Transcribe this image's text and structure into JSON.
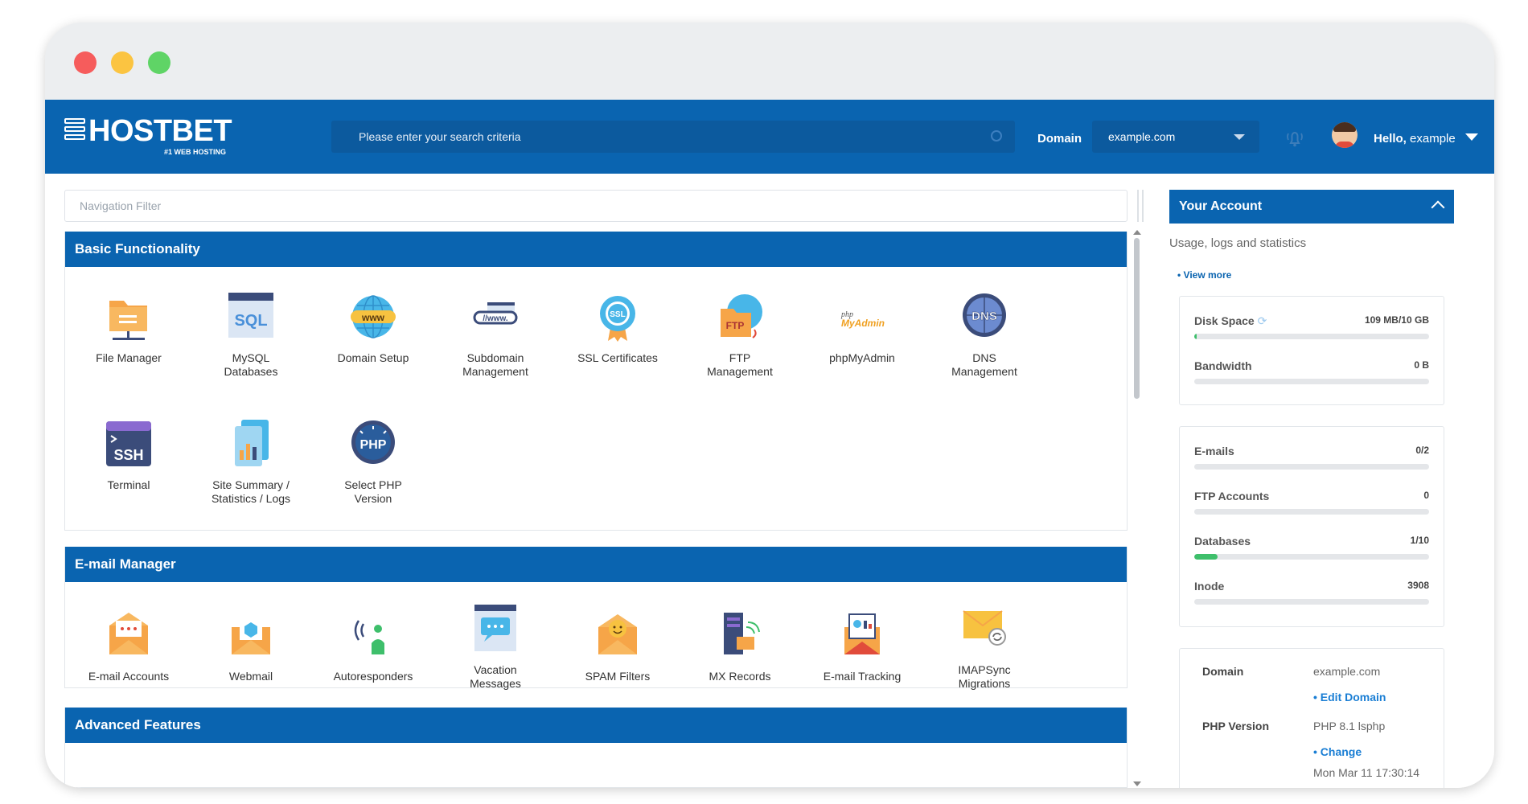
{
  "header": {
    "logo_text": "HOSTBET",
    "logo_sub": "#1 WEB HOSTING",
    "search_placeholder": "Please enter your search criteria",
    "domain_label": "Domain",
    "domain_value": "example.com",
    "hello_prefix": "Hello,",
    "hello_name": "example"
  },
  "nav_filter_placeholder": "Navigation Filter",
  "sections": {
    "basic": {
      "title": "Basic Functionality",
      "items": [
        {
          "label": "File Manager",
          "icon": "folder-icon"
        },
        {
          "label": "MySQL\nDatabases",
          "icon": "sql-icon"
        },
        {
          "label": "Domain Setup",
          "icon": "www-globe-icon"
        },
        {
          "label": "Subdomain\nManagement",
          "icon": "subdomain-icon"
        },
        {
          "label": "SSL Certificates",
          "icon": "ssl-badge-icon"
        },
        {
          "label": "FTP\nManagement",
          "icon": "ftp-icon"
        },
        {
          "label": "phpMyAdmin",
          "icon": "phpmyadmin-icon"
        },
        {
          "label": "DNS\nManagement",
          "icon": "dns-icon"
        },
        {
          "label": "Terminal",
          "icon": "ssh-terminal-icon"
        },
        {
          "label": "Site Summary /\nStatistics / Logs",
          "icon": "statistics-icon"
        },
        {
          "label": "Select PHP\nVersion",
          "icon": "php-gauge-icon"
        }
      ]
    },
    "email": {
      "title": "E-mail Manager",
      "items": [
        {
          "label": "E-mail Accounts",
          "icon": "envelope-icon"
        },
        {
          "label": "Webmail",
          "icon": "webmail-icon"
        },
        {
          "label": "Autoresponders",
          "icon": "autoresponder-icon"
        },
        {
          "label": "Vacation\nMessages",
          "icon": "vacation-icon"
        },
        {
          "label": "SPAM Filters",
          "icon": "spam-filter-icon"
        },
        {
          "label": "MX Records",
          "icon": "mx-records-icon"
        },
        {
          "label": "E-mail Tracking",
          "icon": "email-tracking-icon"
        },
        {
          "label": "IMAPSync\nMigrations",
          "icon": "imapsync-icon"
        }
      ]
    },
    "advanced": {
      "title": "Advanced Features"
    }
  },
  "account": {
    "title": "Your Account",
    "subtitle": "Usage, logs and statistics",
    "view_more": "View more",
    "stats1": [
      {
        "name": "Disk Space",
        "value": "109 MB/10 GB",
        "fill": 0.011
      },
      {
        "name": "Bandwidth",
        "value": "0 B",
        "fill": 0
      }
    ],
    "stats2": [
      {
        "name": "E-mails",
        "value": "0/2",
        "fill": 0
      },
      {
        "name": "FTP Accounts",
        "value": "0",
        "fill": 0
      },
      {
        "name": "Databases",
        "value": "1/10",
        "fill": 0.1
      },
      {
        "name": "Inode",
        "value": "3908",
        "fill": 0
      }
    ],
    "info": {
      "domain_label": "Domain",
      "domain_value": "example.com",
      "edit_domain": "Edit Domain",
      "php_label": "PHP Version",
      "php_value": "PHP 8.1 lsphp",
      "change": "Change",
      "timestamp": "Mon Mar 11 17:30:14"
    }
  },
  "colors": {
    "brand_blue": "#0a64b0",
    "progress_green": "#3ebf6b"
  }
}
